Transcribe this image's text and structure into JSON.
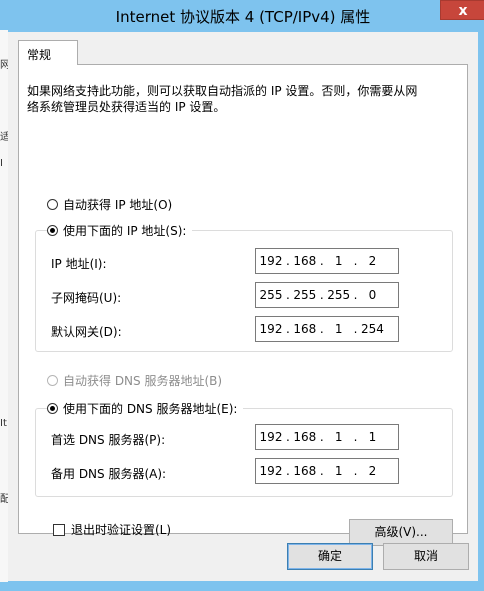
{
  "window": {
    "title": "Internet 协议版本 4 (TCP/IPv4) 属性",
    "close_glyph": "x"
  },
  "tabs": [
    {
      "label": "常规"
    }
  ],
  "description": {
    "line1": "如果网络支持此功能，则可以获取自动指派的 IP 设置。否则，你需要从网",
    "line2": "络系统管理员处获得适当的 IP 设置。"
  },
  "ip_mode": {
    "auto_label": "自动获得 IP 地址(O)",
    "manual_label": "使用下面的 IP 地址(S):",
    "selected": "manual"
  },
  "ip_fields": [
    {
      "label": "IP 地址(I):",
      "octets": [
        "192",
        "168",
        "1",
        "2"
      ]
    },
    {
      "label": "子网掩码(U):",
      "octets": [
        "255",
        "255",
        "255",
        "0"
      ]
    },
    {
      "label": "默认网关(D):",
      "octets": [
        "192",
        "168",
        "1",
        "254"
      ]
    }
  ],
  "dns_mode": {
    "auto_label": "自动获得 DNS 服务器地址(B)",
    "manual_label": "使用下面的 DNS 服务器地址(E):",
    "selected": "manual",
    "auto_disabled": true
  },
  "dns_fields": [
    {
      "label": "首选 DNS 服务器(P):",
      "octets": [
        "192",
        "168",
        "1",
        "1"
      ]
    },
    {
      "label": "备用 DNS 服务器(A):",
      "octets": [
        "192",
        "168",
        "1",
        "2"
      ]
    }
  ],
  "validate_on_exit": {
    "label": "退出时验证设置(L)",
    "checked": false
  },
  "buttons": {
    "advanced": "高级(V)...",
    "ok": "确定",
    "cancel": "取消"
  },
  "background_fragments": [
    "网",
    "适",
    "I",
    "It",
    "配"
  ],
  "colors": {
    "title_bar": "#7ec3ee",
    "close_button": "#c7463b",
    "dialog_bg": "#f0f0f0"
  }
}
